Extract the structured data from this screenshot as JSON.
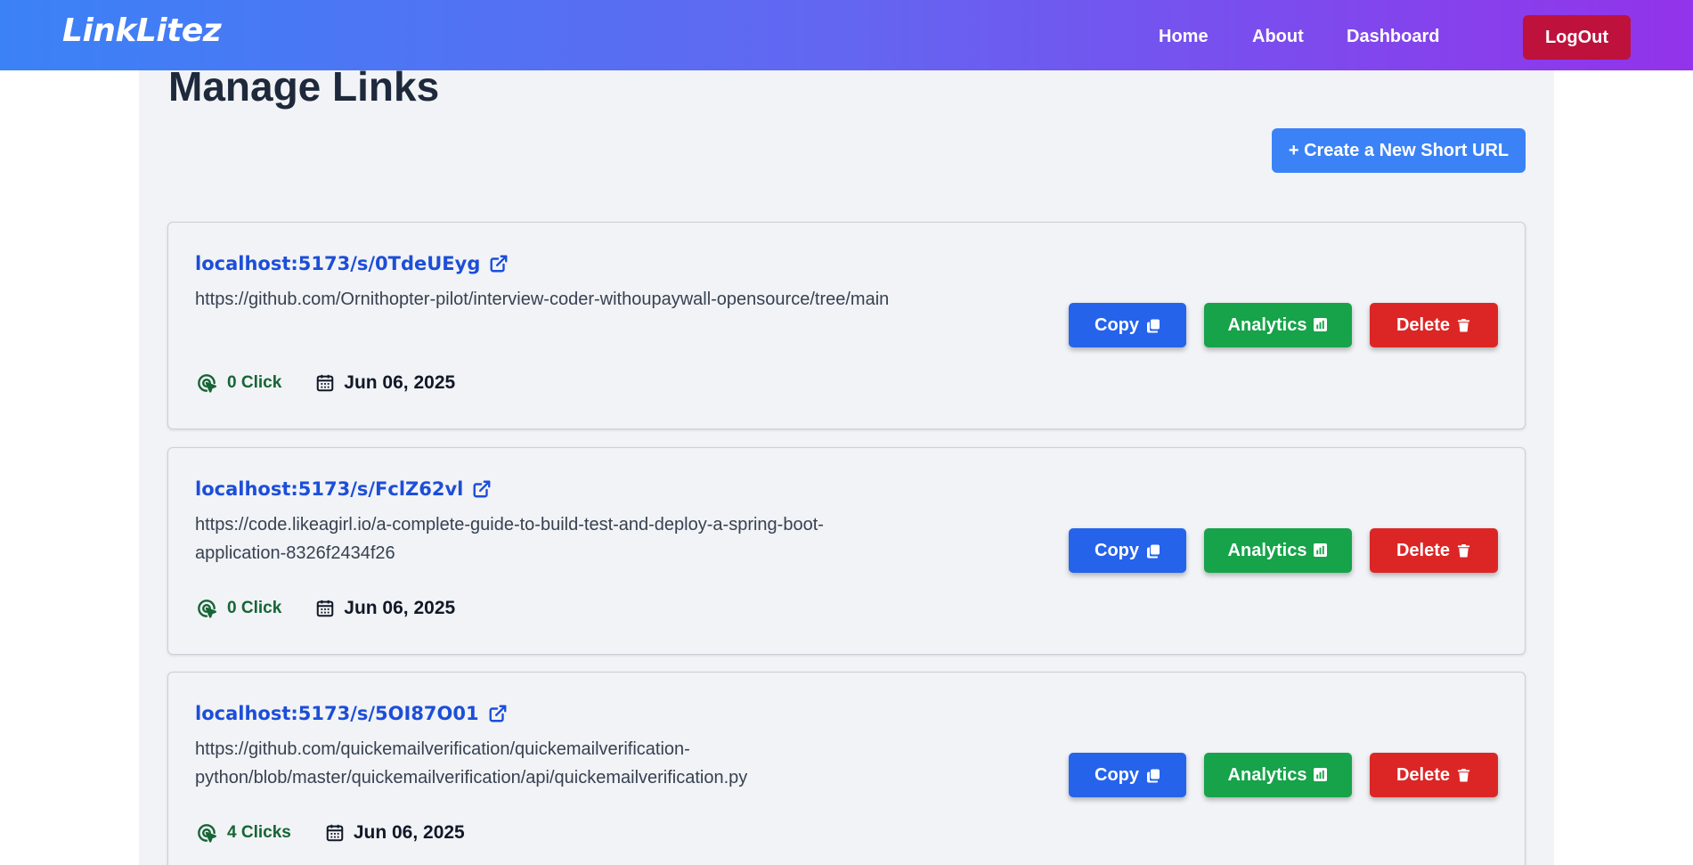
{
  "nav": {
    "brand": "LinkLitez",
    "links": [
      "Home",
      "About",
      "Dashboard"
    ],
    "logout_label": "LogOut"
  },
  "page": {
    "title": "Manage Links",
    "create_button": "+ Create a New Short URL"
  },
  "links": [
    {
      "short_url": "localhost:5173/s/0TdeUEyg",
      "original_url": "https://github.com/Ornithopter-pilot/interview-coder-withoupaywall-opensource/tree/main",
      "clicks": "0 Click",
      "date": "Jun 06, 2025"
    },
    {
      "short_url": "localhost:5173/s/FclZ62vl",
      "original_url": "https://code.likeagirl.io/a-complete-guide-to-build-test-and-deploy-a-spring-boot-application-8326f2434f26",
      "clicks": "0 Click",
      "date": "Jun 06, 2025"
    },
    {
      "short_url": "localhost:5173/s/5OI87O01",
      "original_url": "https://github.com/quickemailverification/quickemailverification-python/blob/master/quickemailverification/api/quickemailverification.py",
      "clicks": "4 Clicks",
      "date": "Jun 06, 2025"
    }
  ],
  "actions": {
    "copy": "Copy",
    "analytics": "Analytics",
    "delete": "Delete"
  },
  "colors": {
    "nav_gradient_start": "#3b82f6",
    "nav_gradient_end": "#9333ea",
    "logout": "#be123c",
    "create": "#3b82f6",
    "copy": "#2563eb",
    "analytics": "#16a34a",
    "delete": "#dc2626",
    "short_link": "#1d4ed8",
    "clicks_text": "#166534"
  },
  "icons": {
    "external_link": "external-link-icon",
    "copy": "copy-icon",
    "analytics": "chart-icon",
    "delete": "trash-icon",
    "clicks": "cursor-click-icon",
    "date": "calendar-icon"
  }
}
